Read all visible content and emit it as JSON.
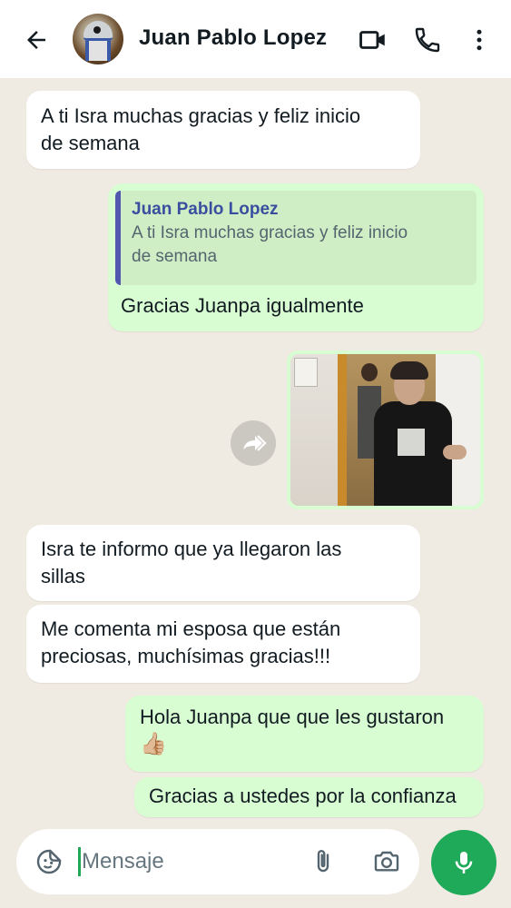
{
  "header": {
    "contact_name": "Juan Pablo Lopez",
    "icons": {
      "back": "arrow-left-icon",
      "video": "video-camera-icon",
      "call": "phone-icon",
      "menu": "more-vertical-icon"
    }
  },
  "messages": [
    {
      "direction": "incoming",
      "text": "A ti Isra muchas gracias y feliz inicio\nde semana"
    },
    {
      "direction": "outgoing",
      "quote": {
        "author": "Juan Pablo Lopez",
        "text": "A ti Isra muchas gracias y feliz inicio\nde semana"
      },
      "text": "Gracias Juanpa igualmente"
    },
    {
      "direction": "outgoing",
      "type": "image",
      "forward_icon": "forward-icon"
    },
    {
      "direction": "incoming",
      "text": "Isra te informo que ya llegaron las\nsillas"
    },
    {
      "direction": "incoming",
      "text": "Me comenta mi esposa que están\npreciosas, muchísimas gracias!!!"
    },
    {
      "direction": "outgoing",
      "text": "Hola Juanpa que que les gustaron",
      "emoji": "👍🏼"
    },
    {
      "direction": "outgoing",
      "text": "Gracias a ustedes por la confianza"
    }
  ],
  "composer": {
    "placeholder": "Mensaje",
    "value": "",
    "icons": {
      "sticker": "sticker-icon",
      "attach": "paperclip-icon",
      "camera": "camera-icon",
      "mic": "microphone-icon"
    }
  },
  "colors": {
    "background": "#efeae2",
    "incoming_bubble": "#ffffff",
    "outgoing_bubble": "#d9fdd3",
    "quote_bar": "#5157ae",
    "accent_green": "#1faa59"
  }
}
